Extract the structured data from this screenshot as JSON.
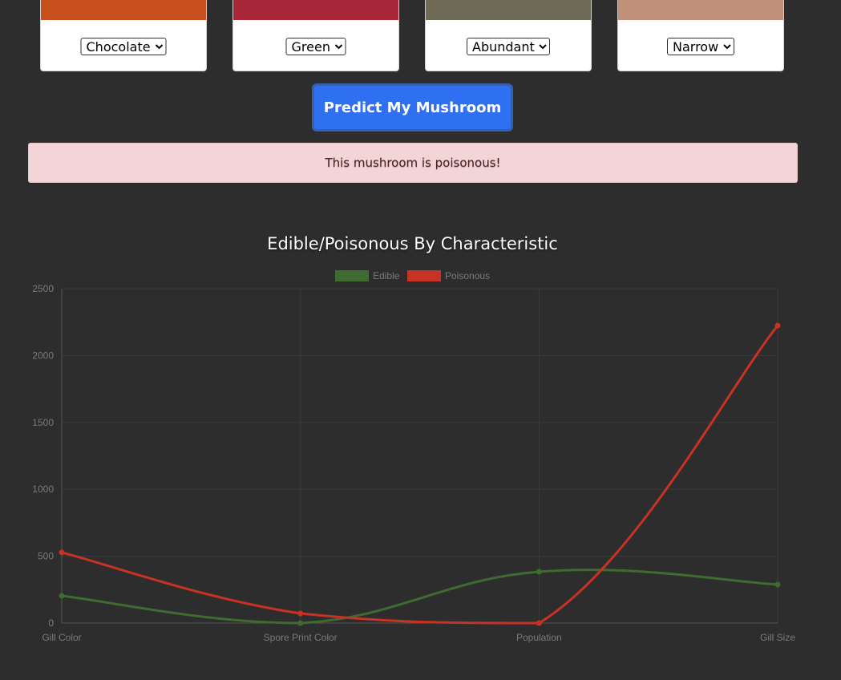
{
  "selectors": [
    {
      "selected": "Chocolate",
      "image_color": "#c8501c"
    },
    {
      "selected": "Green",
      "image_color": "#a8283a"
    },
    {
      "selected": "Abundant",
      "image_color": "#6e6a55"
    },
    {
      "selected": "Narrow",
      "image_color": "#c09078"
    }
  ],
  "predict_button": {
    "label": "Predict My Mushroom"
  },
  "result": {
    "message": "This mushroom is poisonous!"
  },
  "chart_data": {
    "type": "line",
    "title": "Edible/Poisonous By Characteristic",
    "categories": [
      "Gill Color",
      "Spore Print Color",
      "Population",
      "Gill Size"
    ],
    "series": [
      {
        "name": "Edible",
        "color": "#3d6b30",
        "values": [
          204,
          0,
          384,
          288
        ]
      },
      {
        "name": "Poisonous",
        "color": "#c83224",
        "values": [
          528,
          72,
          0,
          2224
        ]
      }
    ],
    "ylim": [
      0,
      2500
    ],
    "yticks": [
      0,
      500,
      1000,
      1500,
      2000,
      2500
    ],
    "grid": true,
    "legend_position": "top-center"
  }
}
